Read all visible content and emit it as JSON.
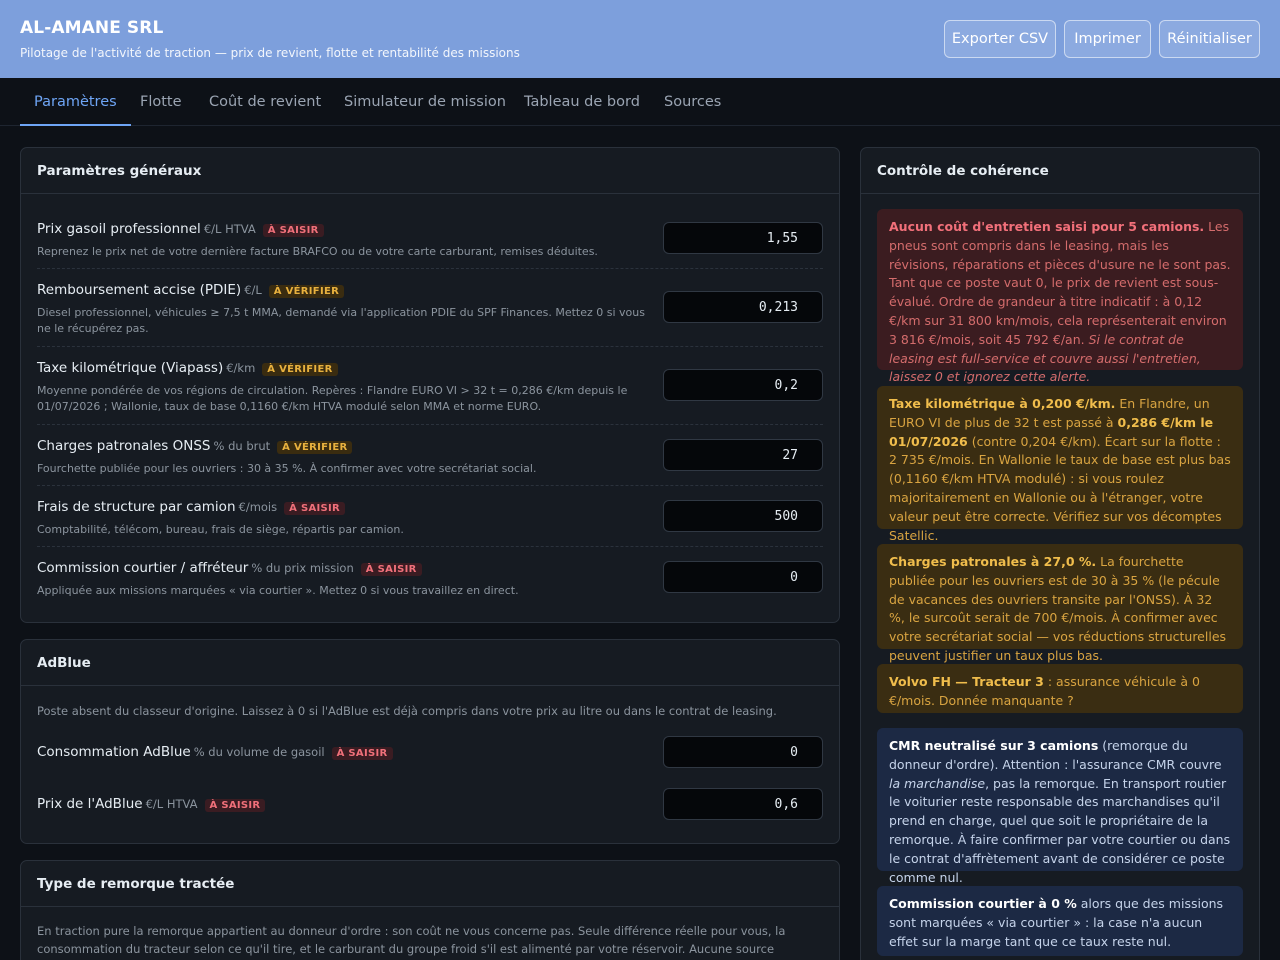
{
  "header": {
    "company": "AL-AMANE SRL",
    "subtitle": "Pilotage de l'activité de traction — prix de revient, flotte et rentabilité des missions",
    "actions": [
      "Exporter CSV",
      "Imprimer",
      "Réinitialiser"
    ]
  },
  "tabs": [
    "Paramètres",
    "Flotte",
    "Coût de revient",
    "Simulateur de mission",
    "Tableau de bord",
    "Sources"
  ],
  "active_tab": "Paramètres",
  "badges": {
    "saisir": "À SAISIR",
    "verifier": "À VÉRIFIER"
  },
  "general": {
    "title": "Paramètres généraux",
    "params": [
      {
        "label": "Prix gasoil professionnel",
        "unit": "€/L HTVA",
        "badge": "À SAISIR",
        "desc": "Reprenez le prix net de votre dernière facture BRAFCO ou de votre carte carburant, remises déduites.",
        "value": "1,55"
      },
      {
        "label": "Remboursement accise (PDIE)",
        "unit": "€/L",
        "badge": "À VÉRIFIER",
        "desc": "Diesel professionnel, véhicules ≥ 7,5 t MMA, demandé via l'application PDIE du SPF Finances. Mettez 0 si vous ne le récupérez pas.",
        "value": "0,213"
      },
      {
        "label": "Taxe kilométrique (Viapass)",
        "unit": "€/km",
        "badge": "À VÉRIFIER",
        "desc": "Moyenne pondérée de vos régions de circulation. Repères : Flandre EURO VI > 32 t = 0,286 €/km depuis le 01/07/2026 ; Wallonie, taux de base 0,1160 €/km HTVA modulé selon MMA et norme EURO.",
        "value": "0,2"
      },
      {
        "label": "Charges patronales ONSS",
        "unit": "% du brut",
        "badge": "À VÉRIFIER",
        "desc": "Fourchette publiée pour les ouvriers : 30 à 35 %. À confirmer avec votre secrétariat social.",
        "value": "27"
      },
      {
        "label": "Frais de structure par camion",
        "unit": "€/mois",
        "badge": "À SAISIR",
        "desc": "Comptabilité, télécom, bureau, frais de siège, répartis par camion.",
        "value": "500"
      },
      {
        "label": "Commission courtier / affréteur",
        "unit": "% du prix mission",
        "badge": "À SAISIR",
        "desc": "Appliquée aux missions marquées « via courtier ». Mettez 0 si vous travaillez en direct.",
        "value": "0"
      }
    ]
  },
  "adblue": {
    "title": "AdBlue",
    "note": "Poste absent du classeur d'origine. Laissez à 0 si l'AdBlue est déjà compris dans votre prix au litre ou dans le contrat de leasing.",
    "params": [
      {
        "label": "Consommation AdBlue",
        "unit": "% du volume de gasoil",
        "badge": "À SAISIR",
        "value": "0"
      },
      {
        "label": "Prix de l'AdBlue",
        "unit": "€/L HTVA",
        "badge": "À SAISIR",
        "value": "0,6"
      }
    ]
  },
  "trailer": {
    "title": "Type de remorque tractée",
    "note": "En traction pure la remorque appartient au donneur d'ordre : son coût ne vous concerne pas. Seule différence réelle pour vous, la consommation du tracteur selon ce qu'il tire, et le carburant du groupe froid s'il est alimenté par votre réservoir. Aucune source publique fiable n'existe pour ces écarts"
  },
  "coherence": {
    "title": "Contrôle de cohérence",
    "alerts": [
      {
        "level": "red",
        "strong": "Aucun coût d'entretien saisi pour 5 camions.",
        "text": " Les pneus sont compris dans le leasing, mais les révisions, réparations et pièces d'usure ne le sont pas. Tant que ce poste vaut 0, le prix de revient est sous-évalué. Ordre de grandeur à titre indicatif : à 0,12 €/km sur 31 800 km/mois, cela représenterait environ 3 816 €/mois, soit 45 792 €/an. ",
        "italic": "Si le contrat de leasing est full-service et couvre aussi l'entretien, laissez 0 et ignorez cette alerte."
      },
      {
        "level": "amber",
        "strong": "Taxe kilométrique à 0,200 €/km.",
        "text": " En Flandre, un EURO VI de plus de 32 t est passé à ",
        "strong2": "0,286 €/km le 01/07/2026",
        "text2": " (contre 0,204 €/km). Écart sur la flotte : 2 735 €/mois. En Wallonie le taux de base est plus bas (0,1160 €/km HTVA modulé) : si vous roulez majoritairement en Wallonie ou à l'étranger, votre valeur peut être correcte. Vérifiez sur vos décomptes Satellic."
      },
      {
        "level": "amber",
        "strong": "Charges patronales à 27,0 %.",
        "text": " La fourchette publiée pour les ouvriers est de 30 à 35 % (le pécule de vacances des ouvriers transite par l'ONSS). À 32 %, le surcoût serait de 700 €/mois. À confirmer avec votre secrétariat social — vos réductions structurelles peuvent justifier un taux plus bas."
      },
      {
        "level": "amber",
        "strong": "Volvo FH — Tracteur 3",
        "text": " : assurance véhicule à 0 €/mois. Donnée manquante ?"
      },
      {
        "level": "blue",
        "strong": "CMR neutralisé sur 3 camions",
        "text": " (remorque du donneur d'ordre). Attention : l'assurance CMR couvre ",
        "italic_mid": "la marchandise",
        "text2": ", pas la remorque. En transport routier le voiturier reste responsable des marchandises qu'il prend en charge, quel que soit le propriétaire de la remorque. À faire confirmer par votre courtier ou dans le contrat d'affrètement avant de considérer ce poste comme nul."
      },
      {
        "level": "blue",
        "strong": "Commission courtier à 0 %",
        "text": " alors que des missions sont marquées « via courtier » : la case n'a aucun effet sur la marge tant que ce taux reste nul."
      }
    ]
  }
}
